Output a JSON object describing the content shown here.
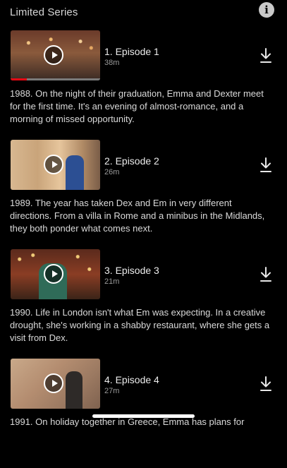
{
  "header": {
    "title": "Limited Series",
    "info_icon": "info-icon"
  },
  "episodes": [
    {
      "title": "1. Episode 1",
      "duration": "38m",
      "progress": 0.18,
      "description": "1988. On the night of their graduation, Emma and Dexter meet for the first time. It's an evening of almost-romance, and a morning of missed opportunity."
    },
    {
      "title": "2. Episode 2",
      "duration": "26m",
      "description": "1989. The year has taken Dex and Em in very different directions. From a villa in Rome and a minibus in the Midlands, they both ponder what comes next."
    },
    {
      "title": "3. Episode 3",
      "duration": "21m",
      "description": "1990. Life in London isn't what Em was expecting. In a creative drought, she's working in a shabby restaurant, where she gets a visit from Dex."
    },
    {
      "title": "4. Episode 4",
      "duration": "27m",
      "description": "1991. On holiday together in Greece, Emma has plans for"
    }
  ],
  "colors": {
    "background": "#000000",
    "progress": "#e50914",
    "text_primary": "#ececec",
    "text_secondary": "#9a9a9a"
  },
  "icons": {
    "play": "play-icon",
    "download": "download-icon"
  }
}
